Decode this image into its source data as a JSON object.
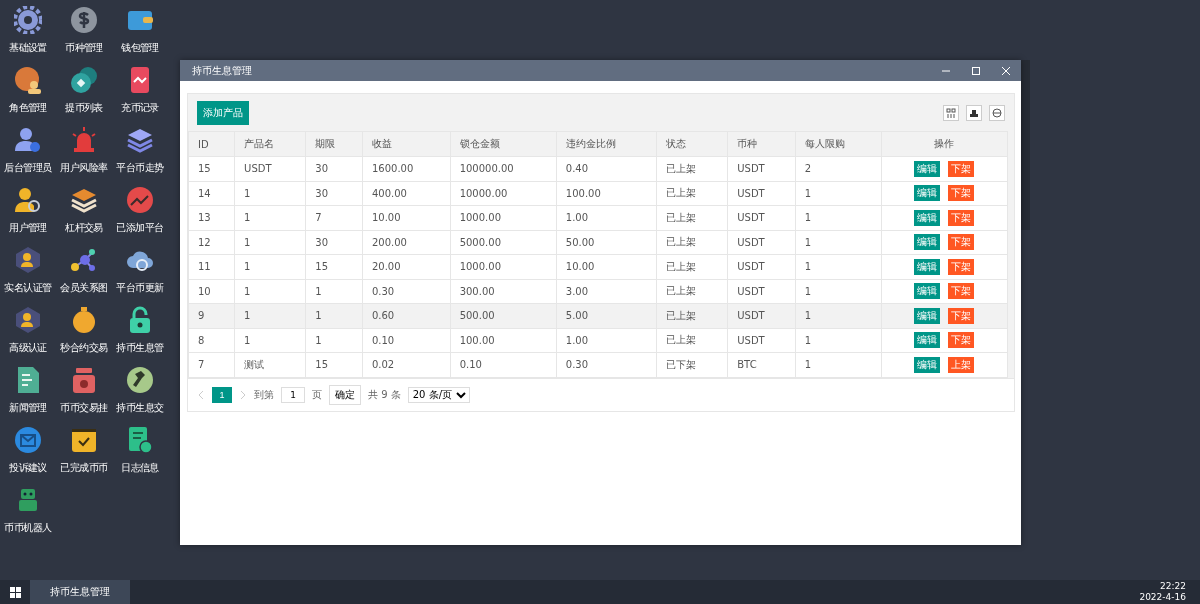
{
  "desktop_icons": [
    {
      "label": "基础设置"
    },
    {
      "label": "币种管理"
    },
    {
      "label": "钱包管理"
    },
    {
      "label": "角色管理"
    },
    {
      "label": "提币列表"
    },
    {
      "label": "充币记录"
    },
    {
      "label": "后台管理员"
    },
    {
      "label": "用户风险率"
    },
    {
      "label": "平台币走势"
    },
    {
      "label": "用户管理"
    },
    {
      "label": "杠杆交易"
    },
    {
      "label": "已添加平台"
    },
    {
      "label": "实名认证管"
    },
    {
      "label": "会员关系图"
    },
    {
      "label": "平台币更新"
    },
    {
      "label": "高级认证"
    },
    {
      "label": "秒合约交易"
    },
    {
      "label": "持币生息管"
    },
    {
      "label": "新闻管理"
    },
    {
      "label": "币币交易挂"
    },
    {
      "label": "持币生息交"
    },
    {
      "label": "投诉建议"
    },
    {
      "label": "已完成币币"
    },
    {
      "label": "日志信息"
    },
    {
      "label": "币币机器人"
    }
  ],
  "window": {
    "title": "持币生息管理"
  },
  "toolbar": {
    "add_button": "添加产品"
  },
  "table": {
    "columns": [
      "ID",
      "产品名",
      "期限",
      "收益",
      "锁仓金额",
      "违约金比例",
      "状态",
      "币种",
      "每人限购",
      "操作"
    ],
    "rows": [
      {
        "cells": [
          "15",
          "USDT",
          "30",
          "1600.00",
          "100000.00",
          "0.40",
          "已上架",
          "USDT",
          "2"
        ],
        "edit": "编辑",
        "toggle": "下架",
        "highlighted": false
      },
      {
        "cells": [
          "14",
          "1",
          "30",
          "400.00",
          "10000.00",
          "100.00",
          "已上架",
          "USDT",
          "1"
        ],
        "edit": "编辑",
        "toggle": "下架",
        "highlighted": false
      },
      {
        "cells": [
          "13",
          "1",
          "7",
          "10.00",
          "1000.00",
          "1.00",
          "已上架",
          "USDT",
          "1"
        ],
        "edit": "编辑",
        "toggle": "下架",
        "highlighted": false
      },
      {
        "cells": [
          "12",
          "1",
          "30",
          "200.00",
          "5000.00",
          "50.00",
          "已上架",
          "USDT",
          "1"
        ],
        "edit": "编辑",
        "toggle": "下架",
        "highlighted": false
      },
      {
        "cells": [
          "11",
          "1",
          "15",
          "20.00",
          "1000.00",
          "10.00",
          "已上架",
          "USDT",
          "1"
        ],
        "edit": "编辑",
        "toggle": "下架",
        "highlighted": false
      },
      {
        "cells": [
          "10",
          "1",
          "1",
          "0.30",
          "300.00",
          "3.00",
          "已上架",
          "USDT",
          "1"
        ],
        "edit": "编辑",
        "toggle": "下架",
        "highlighted": false
      },
      {
        "cells": [
          "9",
          "1",
          "1",
          "0.60",
          "500.00",
          "5.00",
          "已上架",
          "USDT",
          "1"
        ],
        "edit": "编辑",
        "toggle": "下架",
        "highlighted": true
      },
      {
        "cells": [
          "8",
          "1",
          "1",
          "0.10",
          "100.00",
          "1.00",
          "已上架",
          "USDT",
          "1"
        ],
        "edit": "编辑",
        "toggle": "下架",
        "highlighted": false
      },
      {
        "cells": [
          "7",
          "测试",
          "15",
          "0.02",
          "0.10",
          "0.30",
          "已下架",
          "BTC",
          "1"
        ],
        "edit": "编辑",
        "toggle": "上架",
        "highlighted": false
      }
    ]
  },
  "pagination": {
    "pages": [
      {
        "label": "1",
        "selected": true
      }
    ],
    "goto_label": "到第",
    "page_input": "1",
    "page_suffix": "页",
    "confirm": "确定",
    "total": "共 9 条",
    "page_size": "20 条/页"
  },
  "taskbar": {
    "tasks": [
      {
        "label": "持币生息管理",
        "selected": true
      }
    ],
    "time": "22:22",
    "date": "2022-4-16"
  }
}
